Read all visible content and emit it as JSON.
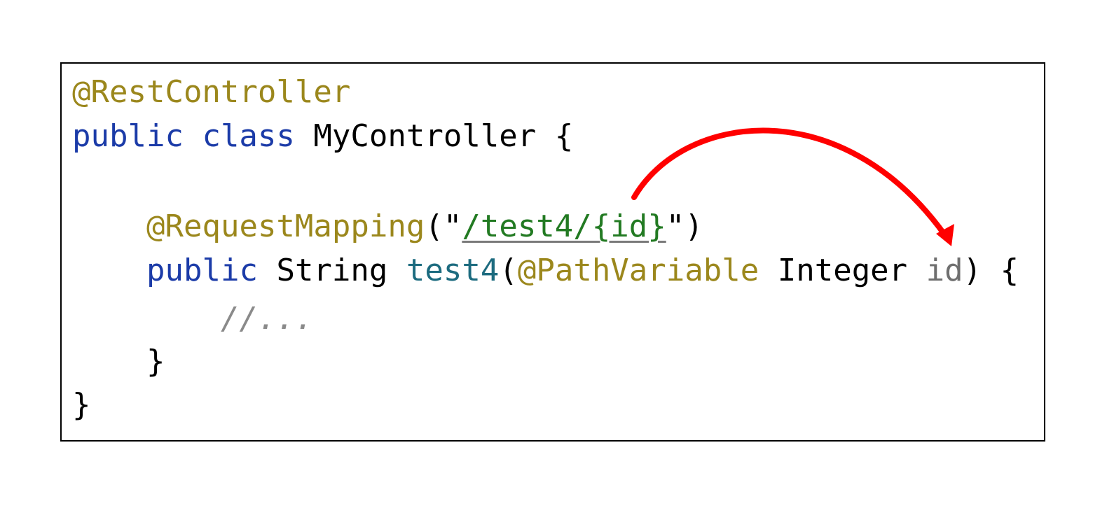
{
  "code": {
    "line1": {
      "annotation": "@RestController"
    },
    "line2": {
      "kw_public": "public",
      "kw_class": "class",
      "name": "MyController {"
    },
    "line4": {
      "annotation": "@RequestMapping",
      "open": "(\"",
      "path": "/test4/{id}",
      "close": "\")"
    },
    "line5": {
      "kw_public": "public",
      "return_type": "String",
      "method": "test4",
      "paren_open": "(",
      "param_annotation": "@PathVariable",
      "param_type": "Integer",
      "param_name": "id",
      "tail": ") {"
    },
    "line6": {
      "comment": "//..."
    },
    "line7": {
      "brace": "}"
    },
    "line8": {
      "brace": "}"
    }
  },
  "colors": {
    "annotation": "#9b871c",
    "keyword": "#1b3ba8",
    "method": "#1c6b7f",
    "string": "#227a22",
    "parameter": "#6f6f6f",
    "comment": "#8a8a8a",
    "arrow": "#ff0000"
  }
}
